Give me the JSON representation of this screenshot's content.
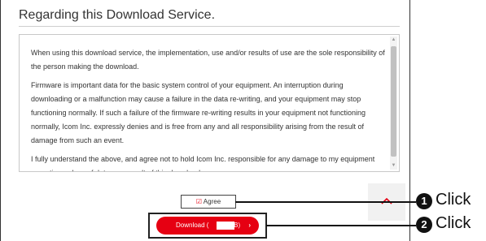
{
  "dialog": {
    "title": "Regarding this Download Service.",
    "terms": [
      "When using this download service, the implementation, use and/or results of use are the sole responsibility of the person making the download.",
      "Firmware is important data for the basic system control of your equipment. An interruption during downloading or a malfunction may cause a failure in the data re-writing, and your equipment may stop functioning normally. If such a failure of the firmware re-writing results in your equipment not functioning normally, Icom Inc. expressly denies and is free from any and all responsibility arising from the result of damage from such an event.",
      "I fully understand the above, and agree not to hold Icom Inc. responsible for any damage to my equipment operation or loss of data as a result of this download."
    ]
  },
  "agree": {
    "check": "☑",
    "label": "Agree"
  },
  "download": {
    "label": "Download (",
    "suffix": "MB)",
    "arrow": "›"
  },
  "callouts": [
    {
      "number": "1",
      "text": "Click"
    },
    {
      "number": "2",
      "text": "Click"
    }
  ],
  "colors": {
    "accent": "#e60012",
    "callout": "#111111"
  },
  "icons": {
    "scroll_top": "chevron-up-icon",
    "agree_check": "check-icon"
  }
}
